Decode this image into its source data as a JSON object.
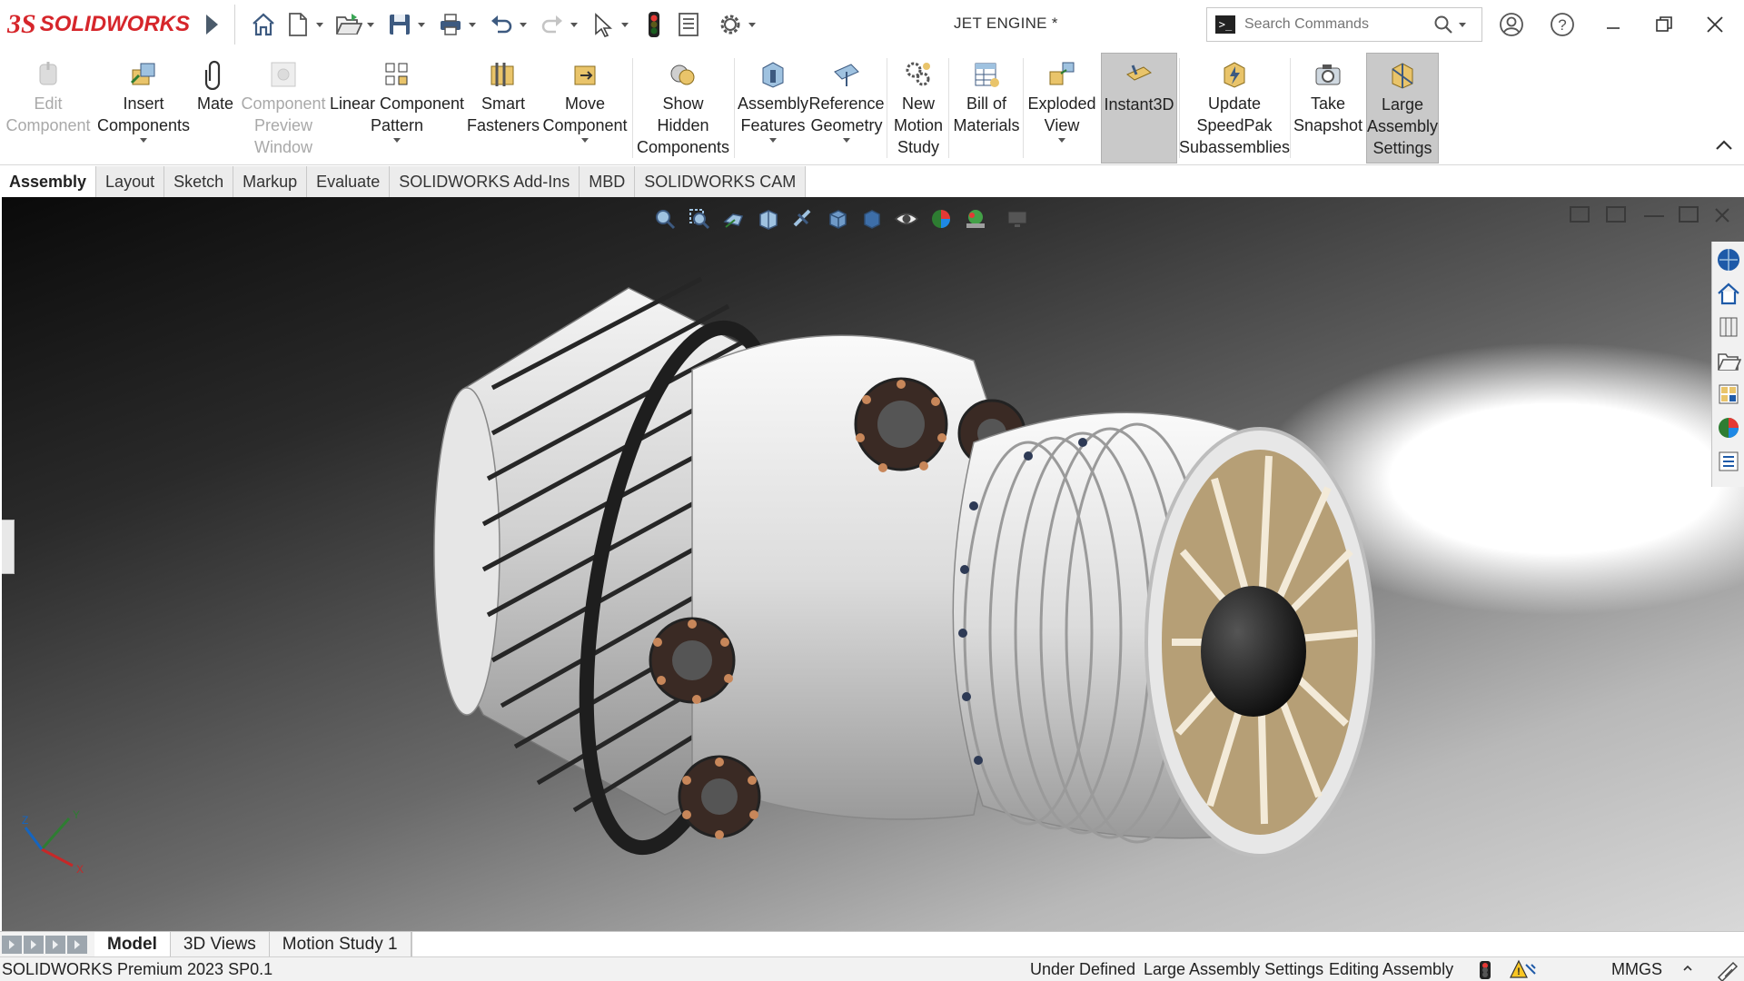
{
  "app": {
    "brand_ds": "3S",
    "brand_name": "SOLIDWORKS",
    "document_title": "JET ENGINE *"
  },
  "search": {
    "placeholder": "Search Commands"
  },
  "ribbon": {
    "items": [
      {
        "line1": "Edit",
        "line2": "Component",
        "line3": "",
        "state": "disabled"
      },
      {
        "line1": "Insert",
        "line2": "Components",
        "line3": "",
        "state": "normal"
      },
      {
        "line1": "Mate",
        "line2": "",
        "line3": "",
        "state": "normal"
      },
      {
        "line1": "Component",
        "line2": "Preview",
        "line3": "Window",
        "state": "disabled"
      },
      {
        "line1": "Linear Component",
        "line2": "Pattern",
        "line3": "",
        "state": "normal"
      },
      {
        "line1": "Smart",
        "line2": "Fasteners",
        "line3": "",
        "state": "normal"
      },
      {
        "line1": "Move",
        "line2": "Component",
        "line3": "",
        "state": "normal"
      },
      {
        "line1": "Show",
        "line2": "Hidden",
        "line3": "Components",
        "state": "normal"
      },
      {
        "line1": "Assembly",
        "line2": "Features",
        "line3": "",
        "state": "normal"
      },
      {
        "line1": "Reference",
        "line2": "Geometry",
        "line3": "",
        "state": "normal"
      },
      {
        "line1": "New",
        "line2": "Motion",
        "line3": "Study",
        "state": "normal"
      },
      {
        "line1": "Bill of",
        "line2": "Materials",
        "line3": "",
        "state": "normal"
      },
      {
        "line1": "Exploded",
        "line2": "View",
        "line3": "",
        "state": "normal"
      },
      {
        "line1": "Instant3D",
        "line2": "",
        "line3": "",
        "state": "active"
      },
      {
        "line1": "Update",
        "line2": "SpeedPak",
        "line3": "Subassemblies",
        "state": "normal"
      },
      {
        "line1": "Take",
        "line2": "Snapshot",
        "line3": "",
        "state": "normal"
      },
      {
        "line1": "Large",
        "line2": "Assembly",
        "line3": "Settings",
        "state": "active"
      }
    ]
  },
  "tabs": [
    "Assembly",
    "Layout",
    "Sketch",
    "Markup",
    "Evaluate",
    "SOLIDWORKS Add-Ins",
    "MBD",
    "SOLIDWORKS CAM"
  ],
  "active_tab": "Assembly",
  "bottom_tabs": [
    "Model",
    "3D Views",
    "Motion Study 1"
  ],
  "active_bottom_tab": "Model",
  "triad": {
    "x": "X",
    "y": "Y",
    "z": "Z"
  },
  "status": {
    "product": "SOLIDWORKS Premium 2023 SP0.1",
    "definition": "Under Defined",
    "mode": "Large Assembly Settings",
    "editing": "Editing Assembly",
    "units": "MMGS"
  },
  "colors": {
    "brand_red": "#d6262b",
    "active_button": "#c9c9c9",
    "viewport_dark": "#0a0a0a",
    "viewport_light": "#ffffff"
  }
}
